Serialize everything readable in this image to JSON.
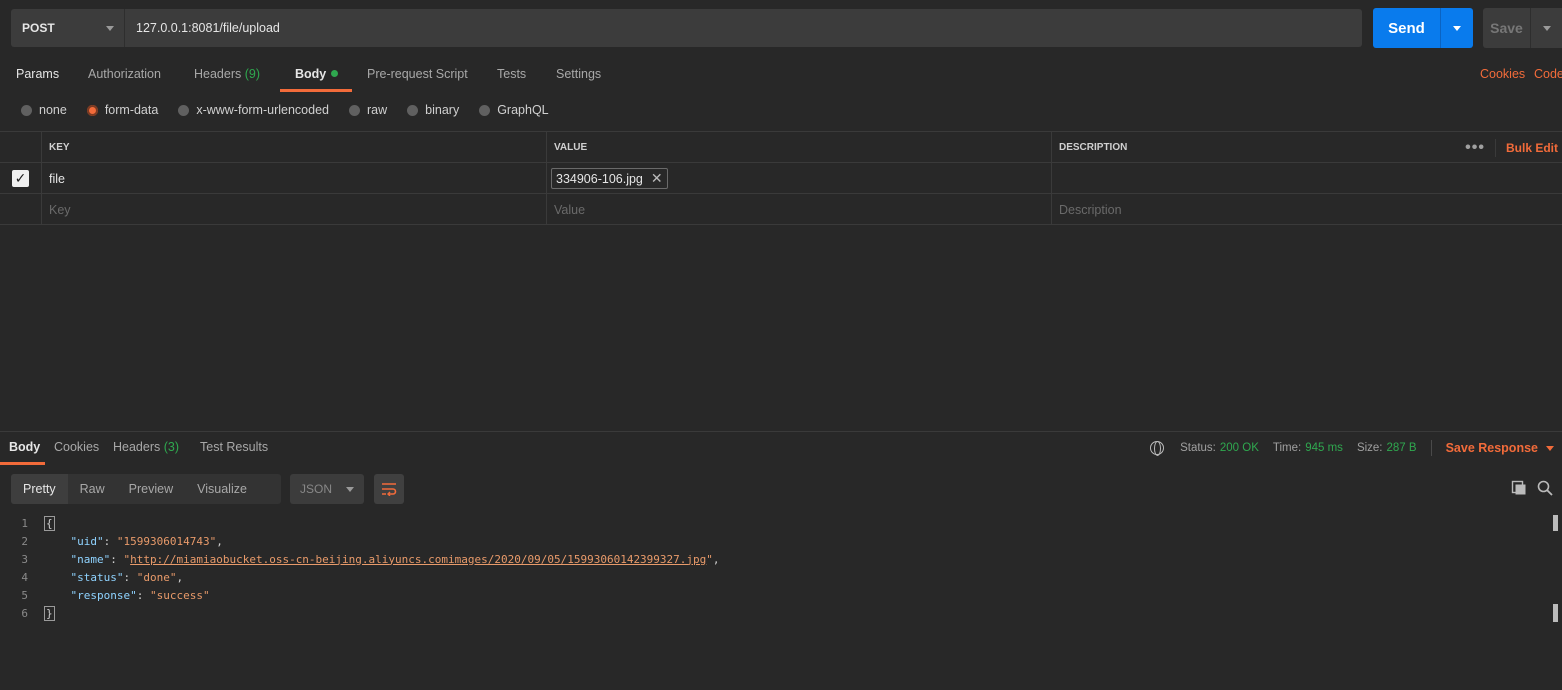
{
  "request": {
    "method": "POST",
    "url": "127.0.0.1:8081/file/upload",
    "send_label": "Send",
    "save_label": "Save"
  },
  "req_tabs": {
    "params": "Params",
    "authorization": "Authorization",
    "headers": "Headers",
    "headers_count": "(9)",
    "body": "Body",
    "pre_request": "Pre-request Script",
    "tests": "Tests",
    "settings": "Settings",
    "cookies": "Cookies",
    "code": "Code"
  },
  "body_types": {
    "none": "none",
    "form_data": "form-data",
    "urlencoded": "x-www-form-urlencoded",
    "raw": "raw",
    "binary": "binary",
    "graphql": "GraphQL",
    "selected": "form-data"
  },
  "table": {
    "headers": {
      "key": "KEY",
      "value": "VALUE",
      "description": "DESCRIPTION",
      "bulk_edit": "Bulk Edit"
    },
    "rows": [
      {
        "checked": true,
        "key": "file",
        "value": "334906-106.jpg",
        "description": ""
      }
    ],
    "placeholders": {
      "key": "Key",
      "value": "Value",
      "description": "Description"
    }
  },
  "response": {
    "tabs": {
      "body": "Body",
      "cookies": "Cookies",
      "headers": "Headers",
      "headers_count": "(3)",
      "test_results": "Test Results"
    },
    "status_label": "Status:",
    "status": "200 OK",
    "time_label": "Time:",
    "time": "945 ms",
    "size_label": "Size:",
    "size": "287 B",
    "save_response": "Save Response",
    "formats": {
      "pretty": "Pretty",
      "raw": "Raw",
      "preview": "Preview",
      "visualize": "Visualize"
    },
    "language": "JSON",
    "line_numbers": [
      "1",
      "2",
      "3",
      "4",
      "5",
      "6"
    ],
    "json": {
      "uid_key": "\"uid\"",
      "uid_val": "\"1599306014743\"",
      "name_key": "\"name\"",
      "name_val": "http://miamiaobucket.oss-cn-beijing.aliyuncs.comimages/2020/09/05/15993060142399327.jpg",
      "status_key": "\"status\"",
      "status_val": "\"done\"",
      "response_key": "\"response\"",
      "response_val": "\"success\""
    }
  },
  "colors": {
    "accent": "#f26b3a",
    "send_blue": "#097bed",
    "success_green": "#2fa84f",
    "background": "#282828"
  }
}
